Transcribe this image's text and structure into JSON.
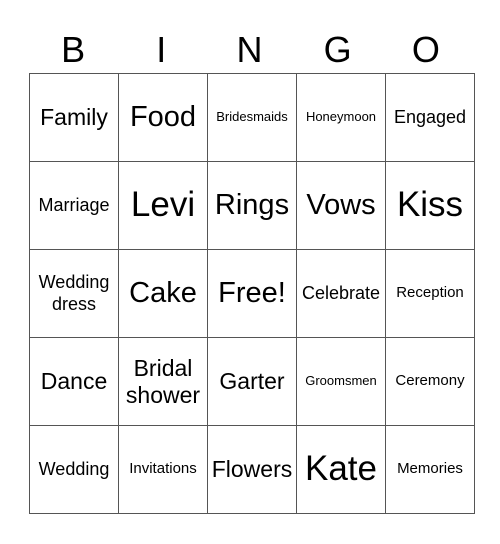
{
  "header": {
    "letters": [
      "B",
      "I",
      "N",
      "G",
      "O"
    ]
  },
  "board": {
    "rows": [
      [
        {
          "text": "Family",
          "size": "s-lg"
        },
        {
          "text": "Food",
          "size": "s-xl"
        },
        {
          "text": "Bridesmaids",
          "size": "s-xs"
        },
        {
          "text": "Honeymoon",
          "size": "s-xs"
        },
        {
          "text": "Engaged",
          "size": "s-md"
        }
      ],
      [
        {
          "text": "Marriage",
          "size": "s-md"
        },
        {
          "text": "Levi",
          "size": "s-xxl"
        },
        {
          "text": "Rings",
          "size": "s-xl"
        },
        {
          "text": "Vows",
          "size": "s-xl"
        },
        {
          "text": "Kiss",
          "size": "s-xxl"
        }
      ],
      [
        {
          "text": "Wedding dress",
          "size": "s-md"
        },
        {
          "text": "Cake",
          "size": "s-xl"
        },
        {
          "text": "Free!",
          "size": "s-xl"
        },
        {
          "text": "Celebrate",
          "size": "s-md"
        },
        {
          "text": "Reception",
          "size": "s-sm"
        }
      ],
      [
        {
          "text": "Dance",
          "size": "s-lg"
        },
        {
          "text": "Bridal shower",
          "size": "s-lg"
        },
        {
          "text": "Garter",
          "size": "s-lg"
        },
        {
          "text": "Groomsmen",
          "size": "s-xs"
        },
        {
          "text": "Ceremony",
          "size": "s-sm"
        }
      ],
      [
        {
          "text": "Wedding",
          "size": "s-md"
        },
        {
          "text": "Invitations",
          "size": "s-sm"
        },
        {
          "text": "Flowers",
          "size": "s-lg"
        },
        {
          "text": "Kate",
          "size": "s-xxl"
        },
        {
          "text": "Memories",
          "size": "s-sm"
        }
      ]
    ]
  }
}
